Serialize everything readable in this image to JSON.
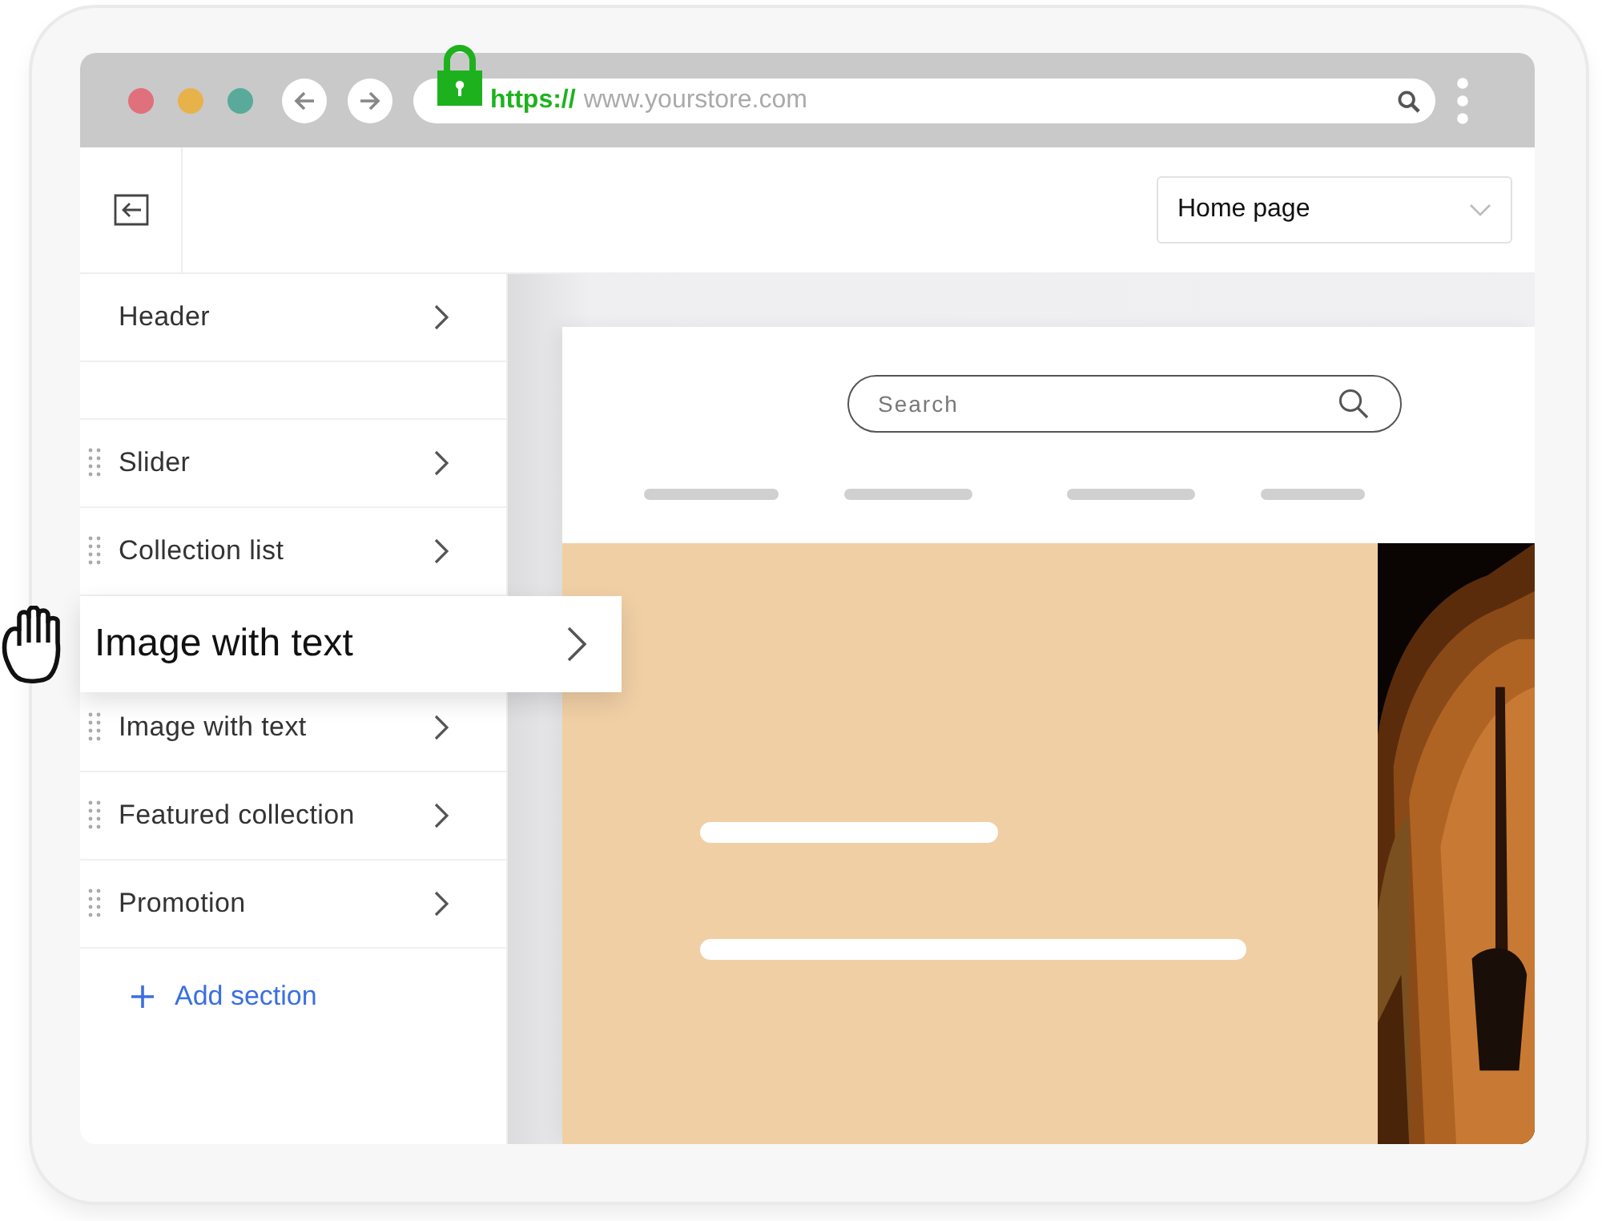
{
  "browser": {
    "url_scheme": "https://",
    "url_host": "www.yourstore.com"
  },
  "toolbar": {
    "page_select": "Home page"
  },
  "sections": [
    {
      "kind": "header",
      "label": "Header"
    },
    {
      "kind": "section",
      "label": "Slider"
    },
    {
      "kind": "section",
      "label": "Collection list"
    },
    {
      "kind": "dragged",
      "label": "Image with text"
    },
    {
      "kind": "section",
      "label": "Image with text"
    },
    {
      "kind": "section",
      "label": "Featured collection"
    },
    {
      "kind": "section",
      "label": "Promotion"
    }
  ],
  "add_section": {
    "label": "Add section"
  },
  "preview": {
    "search": {
      "placeholder": "Search"
    }
  }
}
